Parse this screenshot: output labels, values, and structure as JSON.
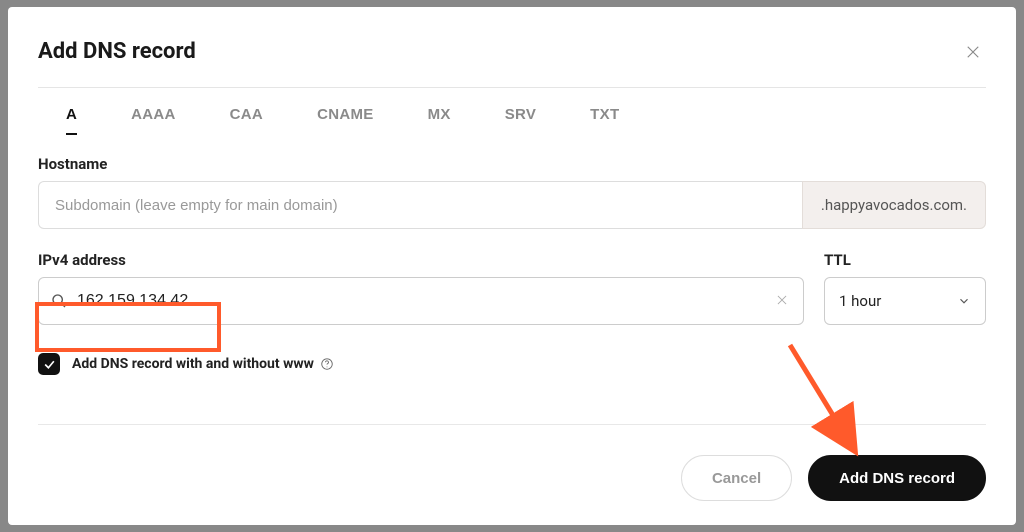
{
  "modal": {
    "title": "Add DNS record"
  },
  "tabs": [
    "A",
    "AAAA",
    "CAA",
    "CNAME",
    "MX",
    "SRV",
    "TXT"
  ],
  "active_tab_index": 0,
  "hostname": {
    "label": "Hostname",
    "placeholder": "Subdomain (leave empty for main domain)",
    "value": "",
    "suffix": ".happyavocados.com."
  },
  "ipv4": {
    "label": "IPv4 address",
    "value": "162.159.134.42"
  },
  "ttl": {
    "label": "TTL",
    "value": "1 hour"
  },
  "checkbox": {
    "checked": true,
    "label": "Add DNS record with and without www"
  },
  "buttons": {
    "cancel": "Cancel",
    "submit": "Add DNS record"
  }
}
